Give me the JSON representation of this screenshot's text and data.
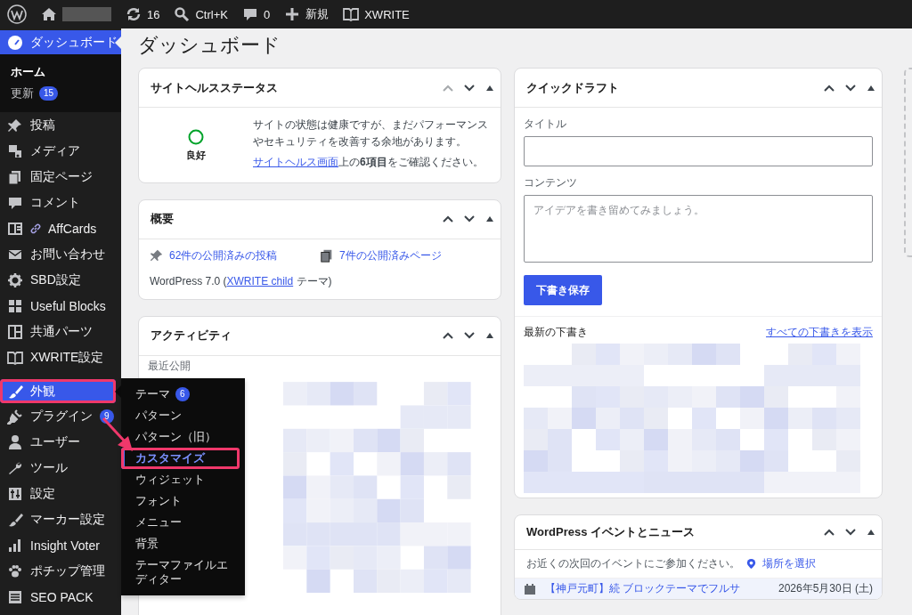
{
  "admin_bar": {
    "updates": "16",
    "search": "Ctrl+K",
    "comments": "0",
    "new": "新規",
    "theme": "XWRITE"
  },
  "sidebar": {
    "items": [
      {
        "label": "ダッシュボード",
        "selected": true,
        "submenu": [
          {
            "label": "ホーム",
            "selected": true
          },
          {
            "label": "更新",
            "badge": "15",
            "selected": false
          }
        ]
      },
      {
        "label": "投稿",
        "selected": false
      },
      {
        "label": "メディア",
        "selected": false
      },
      {
        "label": "固定ページ",
        "selected": false
      },
      {
        "label": "コメント",
        "selected": false
      },
      {
        "label": "AffCards",
        "selected": false
      },
      {
        "label": "お問い合わせ",
        "selected": false
      },
      {
        "label": "SBD設定",
        "selected": false
      },
      {
        "label": "Useful Blocks",
        "selected": false
      },
      {
        "label": "共通パーツ",
        "selected": false
      },
      {
        "label": "XWRITE設定",
        "selected": false
      },
      {
        "label": "外観",
        "selected": true,
        "annotated": true,
        "flyout": [
          {
            "label": "テーマ",
            "badge": "6",
            "selected": false,
            "annotated": false
          },
          {
            "label": "パターン",
            "selected": false,
            "annotated": false
          },
          {
            "label": "パターン（旧）",
            "selected": false,
            "annotated": false
          },
          {
            "label": "カスタマイズ",
            "selected": true,
            "annotated": true
          },
          {
            "label": "ウィジェット",
            "selected": false,
            "annotated": false
          },
          {
            "label": "フォント",
            "selected": false,
            "annotated": false
          },
          {
            "label": "メニュー",
            "selected": false,
            "annotated": false
          },
          {
            "label": "背景",
            "selected": false,
            "annotated": false
          },
          {
            "label": "テーマファイルエディター",
            "selected": false,
            "annotated": false
          }
        ]
      },
      {
        "label": "プラグイン",
        "selected": false,
        "badge": "9"
      },
      {
        "label": "ユーザー",
        "selected": false
      },
      {
        "label": "ツール",
        "selected": false
      },
      {
        "label": "設定",
        "selected": false
      },
      {
        "label": "マーカー設定",
        "selected": false
      },
      {
        "label": "Insight Voter",
        "selected": false
      },
      {
        "label": "ポチップ管理",
        "selected": false
      },
      {
        "label": "SEO PACK",
        "selected": false
      }
    ]
  },
  "page_title": "ダッシュボード",
  "columns": [
    [
      {
        "kind": "site_health",
        "title": "サイトヘルスステータス",
        "up_disabled": true,
        "status": "良好",
        "message": "サイトの状態は健康ですが、まだパフォーマンスやセキュリティを改善する余地があります。",
        "link": "サイトヘルス画面",
        "link_rest": "上の**6項目**をご確認ください。"
      },
      {
        "kind": "glance",
        "title": "概要",
        "up_disabled": false,
        "posts": "62件の公開済みの投稿",
        "pages": "7件の公開済みページ",
        "version_before": "WordPress 7.0 (",
        "theme_link": "XWRITE child",
        "version_after": " テーマ)"
      },
      {
        "kind": "activity",
        "title": "アクティビティ",
        "up_disabled": false,
        "subheading": "最近公開"
      }
    ],
    [
      {
        "kind": "quick_draft",
        "title": "クイックドラフト",
        "up_disabled": false,
        "title_label": "タイトル",
        "content_label": "コンテンツ",
        "content_placeholder": "アイデアを書き留めてみましょう。",
        "button": "下書き保存",
        "drafts_heading": "最新の下書き",
        "view_all": "すべての下書きを表示"
      },
      {
        "kind": "events",
        "title": "WordPress イベントとニュース",
        "up_disabled": false,
        "intro": "お近くの次回のイベントにご参加ください。",
        "location": "場所を選択",
        "event_title": "【神戸元町】続 ブロックテーマでフルサ",
        "event_date": "2026年5月30日 (土)"
      }
    ]
  ]
}
